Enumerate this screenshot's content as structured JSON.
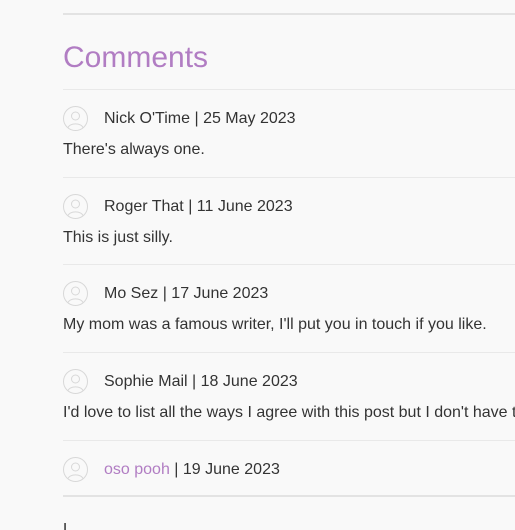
{
  "colors": {
    "accent": "#b17dc3",
    "text": "#333333",
    "background": "#f9f9f9"
  },
  "heading": "Comments",
  "comments": [
    {
      "author": "Nick O'Time",
      "separator": " | ",
      "date": "25 May 2023",
      "text": "There's always one.",
      "avatar_icon": "user-avatar-icon"
    },
    {
      "author": "Roger That",
      "separator": " | ",
      "date": "11 June 2023",
      "text": "This is just silly.",
      "avatar_icon": "user-avatar-icon"
    },
    {
      "author": "Mo Sez",
      "separator": " | ",
      "date": "17 June 2023",
      "text": "My mom was a famous writer, I'll put you in touch if you like.",
      "avatar_icon": "user-avatar-icon"
    },
    {
      "author": "Sophie Mail",
      "separator": " | ",
      "date": "18 June 2023",
      "text": "I'd love to list all the ways I agree with this post but I don't have time",
      "avatar_icon": "user-avatar-icon"
    },
    {
      "author": "oso pooh",
      "author_is_link": true,
      "separator": " | ",
      "date": "19 June 2023",
      "text": "",
      "avatar_icon": "user-avatar-icon"
    }
  ],
  "next_section_partial": "L"
}
